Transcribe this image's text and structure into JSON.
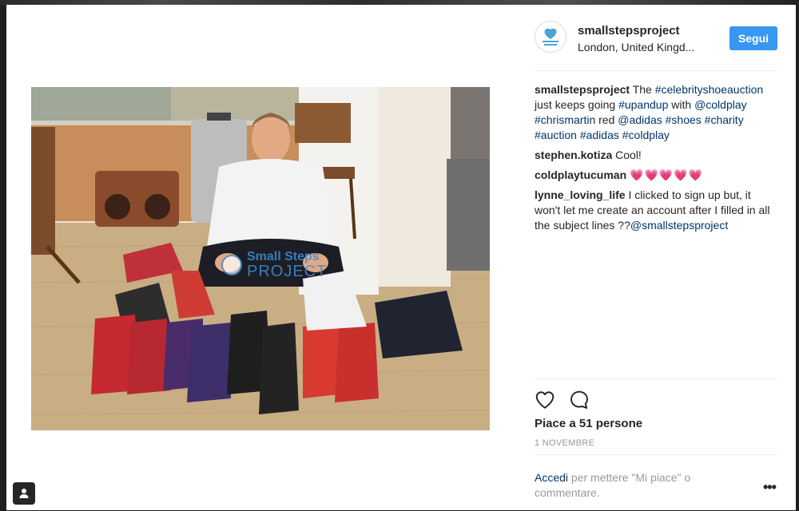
{
  "post": {
    "username": "smallstepsproject",
    "location": "London, United Kingd...",
    "follow_label": "Segui",
    "avatar_text": "Small Steps PROJECT",
    "image_alt": "Man sitting on floor surrounded by sneakers",
    "watermark": {
      "line1": "Small Steps",
      "line2": "PROJECT"
    }
  },
  "caption": {
    "user": "smallstepsproject",
    "word1": "The",
    "tag1": "#celebrityshoeauction",
    "text2": "just keeps going",
    "tag2": "#upandup",
    "text3": "with",
    "tag3": "@coldplay",
    "tag4": "#chrismartin",
    "text4": "red",
    "tag5": "@adidas",
    "tag6": "#shoes",
    "tag7": "#charity",
    "tag8": "#auction",
    "tag9": "#adidas",
    "tag10": "#coldplay"
  },
  "comments": [
    {
      "user": "stephen.kotiza",
      "text": "Cool!"
    },
    {
      "user": "coldplaytucuman",
      "text": "💗💗💗💗💗"
    },
    {
      "user": "lynne_loving_life",
      "text": "I clicked to sign up but, it won't let me create an account after I filled in all the subject lines ??",
      "mention": "@smallstepsproject"
    }
  ],
  "actions": {
    "likes": "Piace a 51 persone",
    "date": "1 NOVEMBRE",
    "login_link": "Accedi",
    "login_rest": "per mettere \"Mi piace\" o commentare.",
    "more": "•••"
  },
  "icons": {
    "like": "heart-outline-icon",
    "comment": "speech-bubble-icon",
    "options": "more-dots-icon",
    "profile": "user-icon"
  },
  "colors": {
    "accent": "#3897f0",
    "hashtag": "#003569",
    "text": "#262626",
    "muted": "#999999"
  }
}
